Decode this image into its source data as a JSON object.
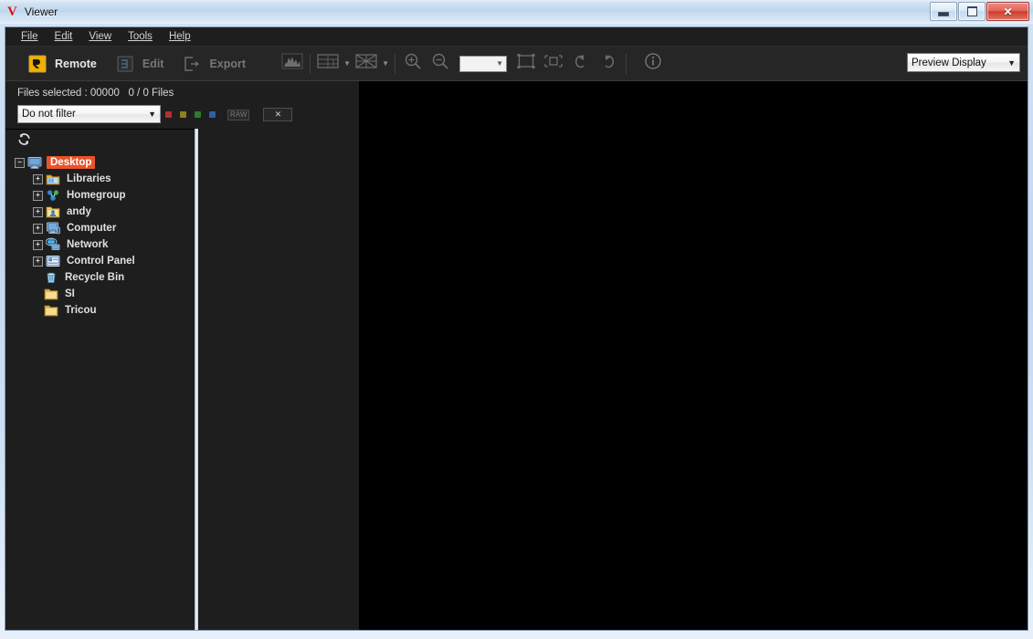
{
  "window": {
    "logo": "V",
    "title": "Viewer",
    "controls": {
      "minimize": "minimize-button",
      "maximize": "maximize-button",
      "close": "✕"
    }
  },
  "menubar": {
    "items": [
      {
        "label": "File",
        "accel": "F"
      },
      {
        "label": "Edit",
        "accel": "E"
      },
      {
        "label": "View",
        "accel": "V"
      },
      {
        "label": "Tools",
        "accel": "T"
      },
      {
        "label": "Help",
        "accel": "H"
      }
    ]
  },
  "toolbar": {
    "remote_label": "Remote",
    "edit_label": "Edit",
    "export_label": "Export",
    "zoom_value": "",
    "icons": [
      "histogram-icon",
      "grid-layout-icon",
      "thumbnail-layout-icon",
      "zoom-in-icon",
      "zoom-out-icon",
      "fit-to-window-icon",
      "actual-size-icon",
      "rotate-left-icon",
      "rotate-right-icon",
      "info-icon"
    ],
    "preview_display": {
      "label": "Preview Display",
      "caret": "▼"
    }
  },
  "filterpanel": {
    "files_selected": "Files selected : 00000   0 / 0 Files",
    "filter": {
      "label": "Do not filter",
      "caret": "▼"
    },
    "color_labels": [
      {
        "name": "red",
        "color": "#b4302e"
      },
      {
        "name": "yellow",
        "color": "#8d8022"
      },
      {
        "name": "green",
        "color": "#2e7a33"
      },
      {
        "name": "blue",
        "color": "#2c5fa8"
      }
    ],
    "raw_badge": "RAW",
    "clear_button": "✕"
  },
  "tree": {
    "refresh_icon": "refresh-icon",
    "nodes": [
      {
        "label": "Desktop",
        "icon": "desktop-icon",
        "indent": 0,
        "expander": "−",
        "selected": true
      },
      {
        "label": "Libraries",
        "icon": "libraries-icon",
        "indent": 1,
        "expander": "+",
        "selected": false
      },
      {
        "label": "Homegroup",
        "icon": "homegroup-icon",
        "indent": 1,
        "expander": "+",
        "selected": false
      },
      {
        "label": "andy",
        "icon": "user-folder-icon",
        "indent": 1,
        "expander": "+",
        "selected": false
      },
      {
        "label": "Computer",
        "icon": "computer-icon",
        "indent": 1,
        "expander": "+",
        "selected": false
      },
      {
        "label": "Network",
        "icon": "network-icon",
        "indent": 1,
        "expander": "+",
        "selected": false
      },
      {
        "label": "Control Panel",
        "icon": "control-panel-icon",
        "indent": 1,
        "expander": "+",
        "selected": false
      },
      {
        "label": "Recycle Bin",
        "icon": "recycle-bin-icon",
        "indent": 1,
        "expander": "",
        "selected": false
      },
      {
        "label": "SI",
        "icon": "folder-icon",
        "indent": 1,
        "expander": "",
        "selected": false
      },
      {
        "label": "Tricou",
        "icon": "folder-icon",
        "indent": 1,
        "expander": "",
        "selected": false
      }
    ]
  },
  "colors": {
    "accent_selection": "#e8542a",
    "toolbar_bg": "#262626",
    "panel_bg": "#1e1e1e",
    "preview_bg": "#000000",
    "titlebar_bg": "#c6daef"
  }
}
